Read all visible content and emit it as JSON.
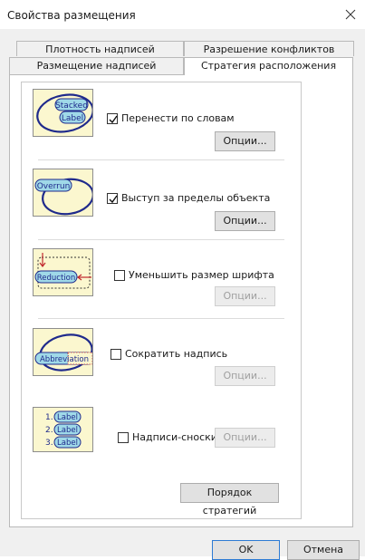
{
  "window": {
    "title": "Свойства размещения"
  },
  "tabs": {
    "row_back": [
      "Плотность надписей",
      "Разрешение конфликтов"
    ],
    "row_front": [
      "Размещение надписей",
      "Стратегия расположения"
    ]
  },
  "strategies": [
    {
      "illustration": [
        "Stacked",
        "Label"
      ],
      "label": "Перенести по словам",
      "checked": true,
      "options": "Опции...",
      "options_enabled": true
    },
    {
      "illustration": [
        "Overrun"
      ],
      "label": "Выступ за пределы объекта",
      "checked": true,
      "options": "Опции...",
      "options_enabled": true
    },
    {
      "illustration": [
        "Reduction"
      ],
      "label": "Уменьшить размер шрифта",
      "checked": false,
      "options": "Опции...",
      "options_enabled": false
    },
    {
      "illustration": [
        "Abbreviation"
      ],
      "label": "Сократить надпись",
      "checked": false,
      "options": "Опции...",
      "options_enabled": false
    },
    {
      "illustration": [
        "1.",
        "Label",
        "2.",
        "Label",
        "3.",
        "Label"
      ],
      "label": "Надписи-сноски",
      "checked": false,
      "options": "Опции...",
      "options_enabled": false
    }
  ],
  "order_button": "Порядок стратегий",
  "footer": {
    "ok": "OK",
    "cancel": "Отмена"
  },
  "colors": {
    "illus_bg": "#fbf7cf",
    "ellipse": "#1f2a8c",
    "label_fill": "#9fd9e8",
    "arrow": "#c0262d",
    "focus": "#2d7bd4"
  }
}
